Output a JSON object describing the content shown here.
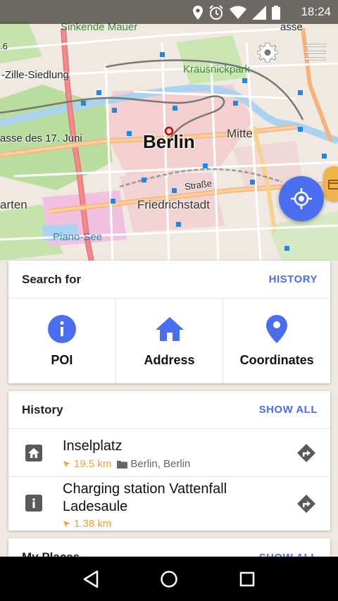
{
  "status_bar": {
    "time": "18:24"
  },
  "map": {
    "labels": {
      "sinkende": "Sinkende Mauer",
      "zille": "-Zille-Siedlung",
      "krausnick": "Krausnickpark",
      "berlin": "Berlin",
      "mitte": "Mitte",
      "juni": "asse des 17. Juni",
      "strasse_top": "asse",
      "strasse": "Straße",
      "friedrichstadt": "Friedrichstadt",
      "garten": "arten",
      "piano": "Piano-See",
      "edge": ".6"
    }
  },
  "search_card": {
    "title": "Search for",
    "action": "HISTORY",
    "items": [
      {
        "label": "POI",
        "icon": "info-circle-icon"
      },
      {
        "label": "Address",
        "icon": "home-icon"
      },
      {
        "label": "Coordinates",
        "icon": "location-pin-icon"
      }
    ]
  },
  "history_card": {
    "title": "History",
    "action": "SHOW ALL",
    "items": [
      {
        "title": "Inselplatz",
        "distance": "19.5 km",
        "place": "Berlin, Berlin",
        "icon": "home-icon"
      },
      {
        "title_line1": "Charging station Vattenfall",
        "title_line2": "Ladesaule",
        "distance": "1.38 km",
        "icon": "info-icon"
      }
    ]
  },
  "places_card": {
    "title": "My Places",
    "action": "SHOW ALL"
  },
  "colors": {
    "accent": "#4a6ef0",
    "distance": "#f0a030",
    "badge": "#f0b44c"
  }
}
